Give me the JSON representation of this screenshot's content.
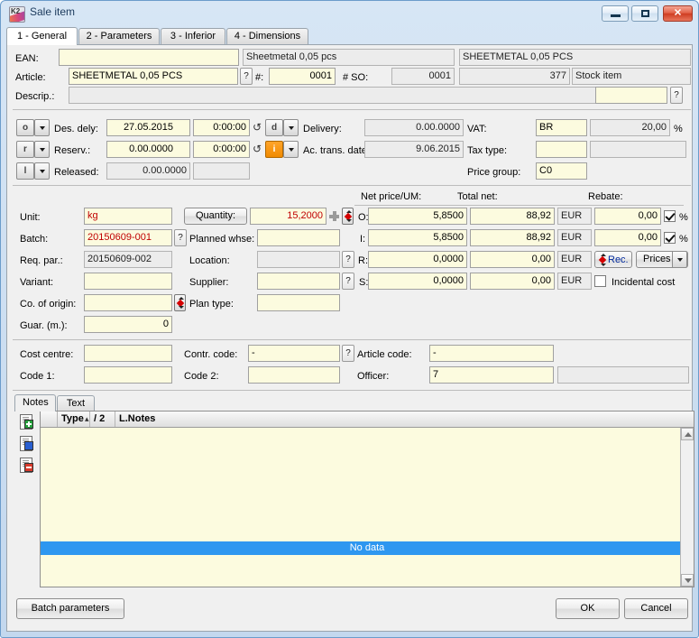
{
  "window": {
    "title": "Sale item",
    "icon": "k2-app-icon",
    "buttons": {
      "minimize": "minimize-button",
      "maximize": "maximize-button",
      "close": "close-button"
    }
  },
  "tabs": [
    {
      "label": "1 - General",
      "active": true
    },
    {
      "label": "2 - Parameters",
      "active": false
    },
    {
      "label": "3 - Inferior",
      "active": false
    },
    {
      "label": "4 - Dimensions",
      "active": false
    }
  ],
  "header": {
    "ean_label": "EAN:",
    "ean_value": "",
    "article_name": "Sheetmetal 0,05 pcs",
    "article_name_upper": "SHEETMETAL 0,05 PCS",
    "article_label": "Article:",
    "article_value": "SHEETMETAL 0,05 PCS",
    "hash_label": "#:",
    "hash_value": "0001",
    "so_label": "# SO:",
    "so_value": "0001",
    "item_number": "377",
    "item_kind": "Stock item",
    "descrip_label": "Descrip.:",
    "descrip_value": "",
    "descrip_extra": ""
  },
  "dates": {
    "des_dely_flag": "o",
    "des_dely_label": "Des. dely:",
    "des_dely_date": "27.05.2015",
    "des_dely_time": "0:00:00",
    "delivery_flag": "d",
    "delivery_label": "Delivery:",
    "delivery_value": "0.00.0000",
    "reserv_flag": "r",
    "reserv_label": "Reserv.:",
    "reserv_date": "0.00.0000",
    "reserv_time": "0:00:00",
    "actrans_flag": "i",
    "actrans_label": "Ac. trans. date:",
    "actrans_value": "9.06.2015",
    "released_flag": "l",
    "released_label": "Released:",
    "released_value": "0.00.0000",
    "released_time": ""
  },
  "tax": {
    "vat_label": "VAT:",
    "vat_code": "BR",
    "vat_rate": "20,00",
    "vat_unit": "%",
    "tax_type_label": "Tax type:",
    "tax_type_value": "",
    "tax_type_desc": "",
    "price_group_label": "Price group:",
    "price_group_value": "C0"
  },
  "item": {
    "unit_label": "Unit:",
    "unit_value": "kg",
    "quantity_button": "Quantity:",
    "quantity_value": "15,2000",
    "batch_label": "Batch:",
    "batch_value": "20150609-001",
    "planned_whse_label": "Planned whse:",
    "planned_whse_value": "",
    "req_par_label": "Req. par.:",
    "req_par_value": "20150609-002",
    "location_label": "Location:",
    "location_value": "",
    "variant_label": "Variant:",
    "variant_value": "",
    "supplier_label": "Supplier:",
    "supplier_value": "",
    "origin_label": "Co. of origin:",
    "origin_value": "",
    "plan_type_label": "Plan type:",
    "plan_type_value": "",
    "guar_label": "Guar. (m.):",
    "guar_value": "0"
  },
  "prices": {
    "col_netprice": "Net price/UM:",
    "col_totalnet": "Total net:",
    "col_rebate": "Rebate:",
    "rows": [
      {
        "code": "O:",
        "net_price": "5,8500",
        "total_net": "88,92",
        "currency": "EUR",
        "rebate": "0,00",
        "rebate_pct": "%",
        "checked": true
      },
      {
        "code": "I:",
        "net_price": "5,8500",
        "total_net": "88,92",
        "currency": "EUR",
        "rebate": "0,00",
        "rebate_pct": "%",
        "checked": true
      },
      {
        "code": "R:",
        "net_price": "0,0000",
        "total_net": "0,00",
        "currency": "EUR",
        "rebate": "",
        "rebate_pct": "",
        "checked": false
      },
      {
        "code": "S:",
        "net_price": "0,0000",
        "total_net": "0,00",
        "currency": "EUR",
        "rebate": "",
        "rebate_pct": "",
        "checked": false
      }
    ],
    "rec_button": "Rec.",
    "prices_button": "Prices",
    "incidental_label": "Incidental cost",
    "incidental_checked": false
  },
  "codes": {
    "cost_centre_label": "Cost centre:",
    "cost_centre_value": "",
    "contr_code_label": "Contr. code:",
    "contr_code_value": "-",
    "article_code_label": "Article code:",
    "article_code_value": "-",
    "code1_label": "Code 1:",
    "code1_value": "",
    "code2_label": "Code 2:",
    "code2_value": "",
    "officer_label": "Officer:",
    "officer_value": "7",
    "officer_desc": ""
  },
  "notes": {
    "tabs": [
      {
        "label": "Notes",
        "active": true
      },
      {
        "label": "Text",
        "active": false
      }
    ],
    "side_actions": [
      {
        "name": "add-note-icon",
        "badge": "green"
      },
      {
        "name": "edit-note-icon",
        "badge": "blue"
      },
      {
        "name": "delete-note-icon",
        "badge": "red"
      }
    ],
    "columns": [
      {
        "label": "Type",
        "sort": "asc"
      },
      {
        "label": "/ 2"
      },
      {
        "label": "L.Notes"
      }
    ],
    "empty_text": "No data",
    "rows": []
  },
  "footer": {
    "batch_parameters": "Batch parameters",
    "ok": "OK",
    "cancel": "Cancel"
  },
  "colors": {
    "field_bg": "#fcfbdf",
    "readonly_bg": "#ececec",
    "selection_blue": "#2e97f0",
    "red_text": "#c00000",
    "window_border": "#6b9ccb"
  }
}
